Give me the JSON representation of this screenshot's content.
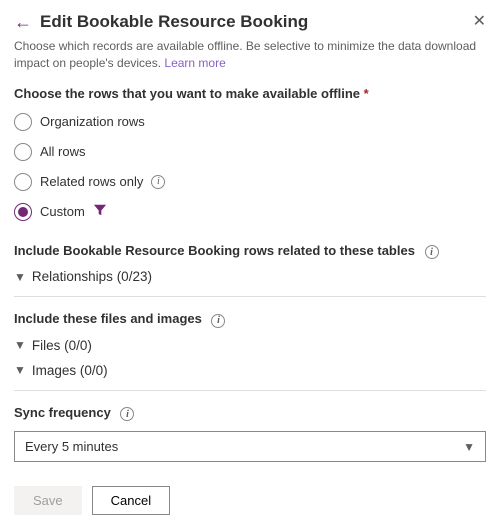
{
  "header": {
    "title": "Edit Bookable Resource Booking",
    "subtitle": "Choose which records are available offline. Be selective to minimize the data download impact on people's devices.",
    "learn_more": "Learn more"
  },
  "rows_section": {
    "label": "Choose the rows that you want to make available offline",
    "required_marker": "*",
    "options": {
      "organization": "Organization rows",
      "all": "All rows",
      "related": "Related rows only",
      "custom": "Custom"
    },
    "selected": "custom"
  },
  "include_related": {
    "label": "Include Bookable Resource Booking rows related to these tables",
    "relationships": {
      "label": "Relationships (0/23)"
    }
  },
  "files_section": {
    "label": "Include these files and images",
    "files": {
      "label": "Files (0/0)"
    },
    "images": {
      "label": "Images (0/0)"
    }
  },
  "sync": {
    "label": "Sync frequency",
    "value": "Every 5 minutes"
  },
  "footer": {
    "save": "Save",
    "cancel": "Cancel"
  }
}
